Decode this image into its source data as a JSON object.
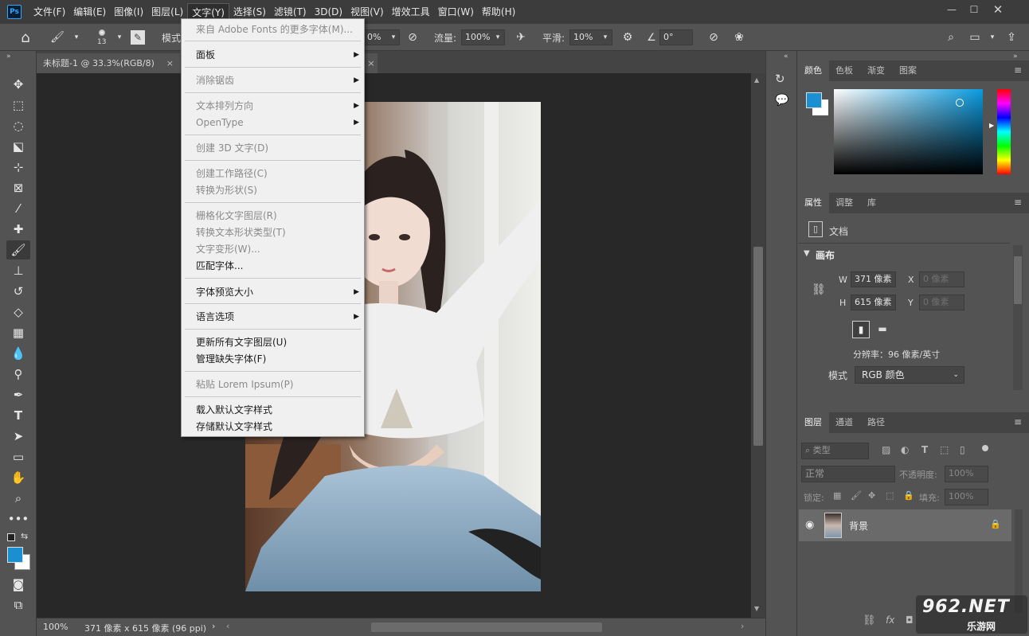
{
  "app": {
    "logo": "Ps"
  },
  "menu": [
    "文件(F)",
    "编辑(E)",
    "图像(I)",
    "图层(L)",
    "文字(Y)",
    "选择(S)",
    "滤镜(T)",
    "3D(D)",
    "视图(V)",
    "增效工具",
    "窗口(W)",
    "帮助(H)"
  ],
  "options": {
    "brush_size": "13",
    "mode_label": "模式",
    "opacity_value": "0%",
    "flow_label": "流量:",
    "flow_value": "100%",
    "smooth_label": "平滑:",
    "smooth_value": "10%",
    "angle_value": "0°"
  },
  "doc_tab": {
    "title": "未标题-1 @ 33.3%(RGB/8)",
    "close": "×"
  },
  "type_menu": {
    "items": [
      {
        "label": "来自 Adobe Fonts 的更多字体(M)...",
        "disabled": true
      },
      {
        "label": "面板",
        "disabled": false,
        "submenu": true
      },
      {
        "label": "消除锯齿",
        "disabled": true,
        "submenu": true
      },
      {
        "label": "文本排列方向",
        "disabled": true,
        "submenu": true
      },
      {
        "label": "OpenType",
        "disabled": true,
        "submenu": true
      },
      {
        "label": "创建 3D 文字(D)",
        "disabled": true
      },
      {
        "label": "创建工作路径(C)",
        "disabled": true
      },
      {
        "label": "转换为形状(S)",
        "disabled": true
      },
      {
        "label": "栅格化文字图层(R)",
        "disabled": true
      },
      {
        "label": "转换文本形状类型(T)",
        "disabled": true
      },
      {
        "label": "文字变形(W)...",
        "disabled": true
      },
      {
        "label": "匹配字体...",
        "disabled": false
      },
      {
        "label": "字体预览大小",
        "disabled": false,
        "submenu": true
      },
      {
        "label": "语言选项",
        "disabled": false,
        "submenu": true
      },
      {
        "label": "更新所有文字图层(U)",
        "disabled": false
      },
      {
        "label": "管理缺失字体(F)",
        "disabled": false
      },
      {
        "label": "粘贴 Lorem Ipsum(P)",
        "disabled": true
      },
      {
        "label": "载入默认文字样式",
        "disabled": false
      },
      {
        "label": "存储默认文字样式",
        "disabled": false
      }
    ]
  },
  "status": {
    "zoom": "100%",
    "doc_info": "371 像素 x 615 像素 (96 ppi)"
  },
  "color_panel": {
    "tabs": [
      "颜色",
      "色板",
      "渐变",
      "图案"
    ],
    "fg_color": "#1a8fd1",
    "bg_color": "#ffffff"
  },
  "properties_panel": {
    "tabs": [
      "属性",
      "调整",
      "库"
    ],
    "doc_label": "文档",
    "canvas_title": "画布",
    "w_label": "W",
    "w_value": "371 像素",
    "h_label": "H",
    "h_value": "615 像素",
    "x_label": "X",
    "x_value": "0 像素",
    "y_label": "Y",
    "y_value": "0 像素",
    "resolution": "分辨率：96 像素/英寸",
    "mode_label": "模式",
    "mode_value": "RGB 颜色"
  },
  "layers_panel": {
    "tabs": [
      "图层",
      "通道",
      "路径"
    ],
    "filter_label": "类型",
    "blend_mode": "正常",
    "opacity_label": "不透明度:",
    "opacity_value": "100%",
    "lock_label": "锁定:",
    "fill_label": "填充:",
    "fill_value": "100%",
    "layer_name": "背景"
  },
  "watermark": {
    "line1": "962.NET",
    "line2": "乐游网"
  }
}
